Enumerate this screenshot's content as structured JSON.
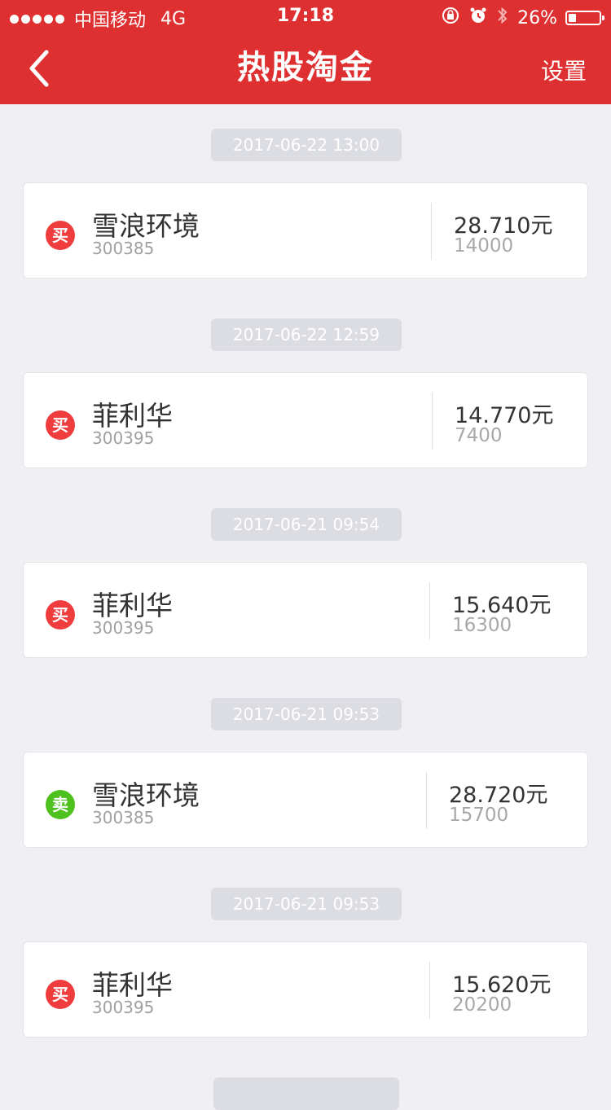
{
  "statusbar": {
    "carrier": "中国移动",
    "network": "4G",
    "time": "17:18",
    "battery": "26%"
  },
  "navbar": {
    "title": "热股淘金",
    "settings": "设置"
  },
  "records": [
    {
      "datetime": "2017-06-22 13:00",
      "action": "买",
      "name": "雪浪环境",
      "code": "300385",
      "price": "28.710元",
      "volume": "14000"
    },
    {
      "datetime": "2017-06-22 12:59",
      "action": "买",
      "name": "菲利华",
      "code": "300395",
      "price": "14.770元",
      "volume": "7400"
    },
    {
      "datetime": "2017-06-21 09:54",
      "action": "买",
      "name": "菲利华",
      "code": "300395",
      "price": "15.640元",
      "volume": "16300"
    },
    {
      "datetime": "2017-06-21 09:53",
      "action": "卖",
      "name": "雪浪环境",
      "code": "300385",
      "price": "28.720元",
      "volume": "15700"
    },
    {
      "datetime": "2017-06-21 09:53",
      "action": "买",
      "name": "菲利华",
      "code": "300395",
      "price": "15.620元",
      "volume": "20200"
    }
  ],
  "colors": {
    "brand": "#df3031",
    "buy": "#ef3d3e",
    "sell": "#4fc11f"
  }
}
